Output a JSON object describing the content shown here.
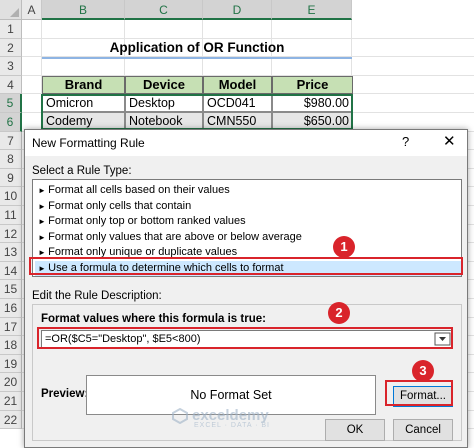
{
  "sheet": {
    "columns": [
      "A",
      "B",
      "C",
      "D",
      "E"
    ],
    "rows": [
      "1",
      "2",
      "3",
      "4",
      "5",
      "6",
      "7",
      "8",
      "9",
      "10",
      "11",
      "12",
      "13",
      "14",
      "15",
      "16",
      "17",
      "18",
      "19",
      "20",
      "21",
      "22"
    ],
    "title": "Application of OR Function",
    "table": {
      "headers": [
        "Brand",
        "Device",
        "Model",
        "Price"
      ],
      "rows": [
        [
          "Omicron",
          "Desktop",
          "OCD041",
          "$980.00"
        ],
        [
          "Codemy",
          "Notebook",
          "CMN550",
          "$650.00"
        ]
      ]
    }
  },
  "dialog": {
    "title": "New Formatting Rule",
    "help": "?",
    "close": "✕",
    "select_rule_type_label": "Select a Rule Type:",
    "rule_types": [
      "Format all cells based on their values",
      "Format only cells that contain",
      "Format only top or bottom ranked values",
      "Format only values that are above or below average",
      "Format only unique or duplicate values",
      "Use a formula to determine which cells to format"
    ],
    "selected_rule_index": 5,
    "edit_description_label": "Edit the Rule Description:",
    "formula_label": "Format values where this formula is true:",
    "formula_value": "=OR($C5=\"Desktop\", $E5<800)",
    "preview_label": "Preview:",
    "preview_text": "No Format Set",
    "format_button": "Format...",
    "ok_button": "OK",
    "cancel_button": "Cancel"
  },
  "callouts": [
    "1",
    "2",
    "3"
  ],
  "watermark": {
    "name": "exceldemy",
    "tagline": "EXCEL · DATA · BI"
  },
  "colors": {
    "accent_green": "#217346",
    "header_fill": "#c6e0b4",
    "callout_red": "#d9242b",
    "selection_blue": "#cde8ff"
  }
}
